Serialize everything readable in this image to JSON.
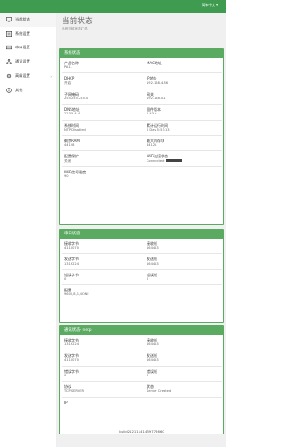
{
  "header": {
    "lang": "简体中文 ▾"
  },
  "sidebar": {
    "items": [
      {
        "label": "当前状态",
        "icon": "monitor-icon"
      },
      {
        "label": "系统设置",
        "icon": "settings-icon"
      },
      {
        "label": "串口设置",
        "icon": "serial-icon"
      },
      {
        "label": "通讯设置",
        "icon": "network-icon"
      },
      {
        "label": "高级设置",
        "icon": "advanced-icon",
        "chevron": "›"
      },
      {
        "label": "其他",
        "icon": "info-icon"
      }
    ]
  },
  "page": {
    "title": "当前状态",
    "subtitle": "系统当前状态汇总"
  },
  "system": {
    "title": "系统状态",
    "rows": [
      [
        {
          "label": "产品名称",
          "value": "PA11"
        },
        {
          "label": "MAC地址",
          "value": ""
        }
      ],
      [
        {
          "label": "DHCP",
          "value": "开启"
        },
        {
          "label": "IP地址",
          "value": "192.168.4.86"
        }
      ],
      [
        {
          "label": "子网掩码",
          "value": "255.255.255.0"
        },
        {
          "label": "网关",
          "value": "192.168.0.1"
        }
      ],
      [
        {
          "label": "DNS地址",
          "value": "223.5.4.4"
        },
        {
          "label": "固件版本",
          "value": "1.43.0"
        }
      ],
      [
        {
          "label": "系统时间",
          "value": "NTP Disabled"
        },
        {
          "label": "累计运行时间",
          "value": "0 Day 5:53:13"
        }
      ],
      [
        {
          "label": "剩余RAM",
          "value": "44128"
        },
        {
          "label": "最大内存块",
          "value": "44128"
        }
      ],
      [
        {
          "label": "配置保护",
          "value": "关闭"
        },
        {
          "label": "WiFi连接状态",
          "value": "Connected:"
        }
      ],
      [
        {
          "label": "WiFi信号强度",
          "value": "90"
        }
      ]
    ]
  },
  "serial": {
    "title": "串口状态",
    "rows": [
      [
        {
          "label": "接收字节",
          "value": "4110070"
        },
        {
          "label": "接收帧",
          "value": "164483"
        }
      ],
      [
        {
          "label": "发送字节",
          "value": "1319224"
        },
        {
          "label": "发送帧",
          "value": "164483"
        }
      ],
      [
        {
          "label": "错误字节",
          "value": "0"
        },
        {
          "label": "错误帧",
          "value": "0"
        }
      ],
      [
        {
          "label": "配置",
          "value": "9600,8,1,NONE"
        }
      ]
    ]
  },
  "netp": {
    "title": "通讯状态- netp",
    "rows": [
      [
        {
          "label": "接收字节",
          "value": "1319224"
        },
        {
          "label": "接收帧",
          "value": "164483"
        }
      ],
      [
        {
          "label": "发送字节",
          "value": "4110070"
        },
        {
          "label": "发送帧",
          "value": "164483"
        }
      ],
      [
        {
          "label": "错误字节",
          "value": "0"
        },
        {
          "label": "错误帧",
          "value": "0"
        }
      ],
      [
        {
          "label": "协议",
          "value": "TCP-SERVER"
        },
        {
          "label": "状态",
          "value": "Server Created"
        }
      ],
      [
        {
          "label": "IP",
          "value": ""
        }
      ]
    ]
  },
  "footer": {
    "build": "build21211141439776660"
  },
  "colors": {
    "accent": "#5aaa62",
    "topbar": "#3e9b4f",
    "background": "#f0f0f0"
  }
}
